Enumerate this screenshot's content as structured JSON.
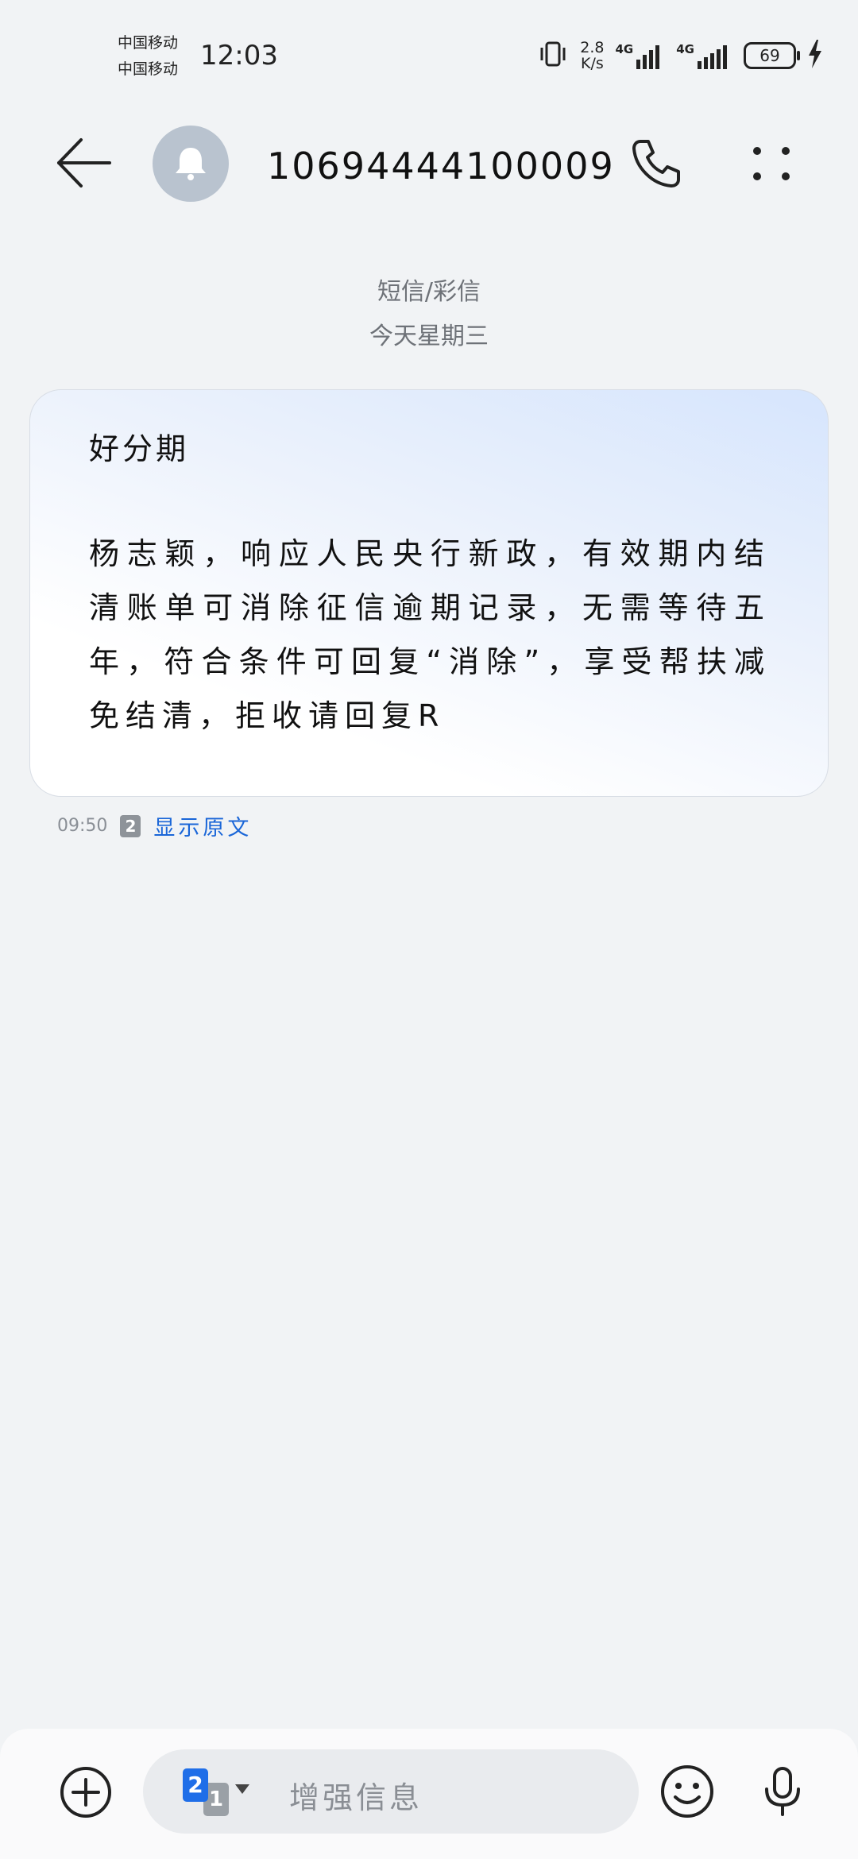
{
  "status_bar": {
    "carrier_1": "中国移动",
    "carrier_2": "中国移动",
    "time": "12:03",
    "net_speed_value": "2.8",
    "net_speed_unit": "K/s",
    "signal_1_label": "4G",
    "signal_2_label": "4G",
    "battery_level": "69"
  },
  "header": {
    "contact_number": "10694444100009"
  },
  "thread": {
    "channel_label": "短信/彩信",
    "date_label": "今天星期三"
  },
  "message": {
    "sender_tag": "好分期",
    "body": "杨志颖，响应人民央行新政，有效期内结清账单可消除征信逾期记录，无需等待五年，符合条件可回复“消除”，享受帮扶减免结清，拒收请回复R",
    "time": "09:50",
    "sim_slot": "2",
    "show_original_label": "显示原文"
  },
  "composer": {
    "sim_active": "2",
    "sim_other": "1",
    "placeholder": "增强信息"
  },
  "colors": {
    "background": "#f1f3f5",
    "link": "#1a66d8",
    "sim_active": "#1f6ee8",
    "avatar": "#b9c3cf"
  },
  "icons": {
    "back": "arrow-left-icon",
    "avatar": "bell-icon",
    "call": "phone-icon",
    "more": "four-dots-icon",
    "add": "plus-circle-icon",
    "emoji": "smiley-icon",
    "mic": "microphone-icon"
  }
}
